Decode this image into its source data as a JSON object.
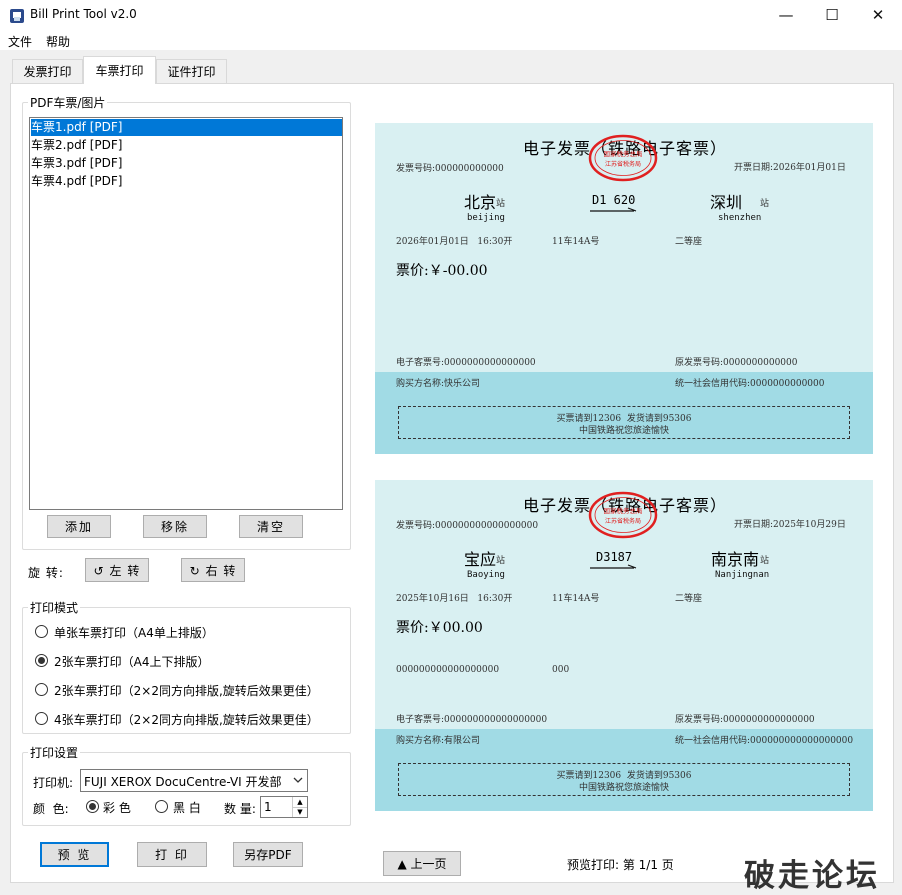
{
  "window": {
    "title": "Bill Print Tool v2.0",
    "minimize": "—",
    "maximize": "☐",
    "close": "✕"
  },
  "menu": {
    "file": "文件",
    "help": "帮助"
  },
  "tabs": [
    "发票打印",
    "车票打印",
    "证件打印"
  ],
  "file_group": {
    "title": "PDF车票/图片",
    "files": [
      "车票1.pdf [PDF]",
      "车票2.pdf [PDF]",
      "车票3.pdf [PDF]",
      "车票4.pdf [PDF]"
    ],
    "selected_index": 0,
    "add": "添加",
    "remove": "移除",
    "clear": "清空"
  },
  "rotate": {
    "label": "旋 转:",
    "left": "↺ 左 转",
    "right": "↻ 右 转"
  },
  "mode_group": {
    "title": "打印模式",
    "options": [
      "单张车票打印（A4单上排版）",
      "2张车票打印（A4上下排版）",
      "2张车票打印（2×2同方向排版,旋转后效果更佳）",
      "4张车票打印（2×2同方向排版,旋转后效果更佳）"
    ],
    "selected_index": 1
  },
  "settings_group": {
    "title": "打印设置",
    "printer_label": "打印机:",
    "printer_value": "FUJI XEROX DocuCentre-VI 开发部",
    "color_label": "颜  色:",
    "color_option": "彩 色",
    "bw_option": "黑 白",
    "qty_label": "数 量:",
    "qty_value": "1"
  },
  "actions": {
    "preview": "预 览",
    "print": "打 印",
    "save_pdf": "另存PDF"
  },
  "preview_nav": {
    "prev": "▲ 上一页",
    "status": "预览打印: 第 1/1 页"
  },
  "tickets": [
    {
      "title": "电子发票（铁路电子客票）",
      "invoice_no": "发票号码:000000000000",
      "date": "开票日期:2026年01月01日",
      "from_city": "北京",
      "from_pinyin": "beijing",
      "to_city": "深圳",
      "to_pinyin": "shenzhen",
      "station_suffix": "站",
      "train": "D1 620",
      "depart": "2026年01月01日   16:30开",
      "seat_no": "11车14A号",
      "seat_class": "二等座",
      "price": "票价:￥-00.00",
      "extra_id": "",
      "extra_code": "",
      "eticket_no": "电子客票号:0000000000000000",
      "orig_invoice": "原发票号码:0000000000000",
      "buyer": "购买方名称:快乐公司",
      "credit_code": "统一社会信用代码:0000000000000",
      "notice1": "买票请到12306  发货请到95306",
      "notice2": "中国铁路祝您旅途愉快"
    },
    {
      "title": "电子发票（铁路电子客票）",
      "invoice_no": "发票号码:000000000000000000",
      "date": "开票日期:2025年10月29日",
      "from_city": "宝应",
      "from_pinyin": "Baoying",
      "to_city": "南京南",
      "to_pinyin": "Nanjingnan",
      "station_suffix": "站",
      "train": "D3187",
      "depart": "2025年10月16日   16:30开",
      "seat_no": "11车14A号",
      "seat_class": "二等座",
      "price": "票价:￥00.00",
      "extra_id": "000000000000000000",
      "extra_code": "000",
      "eticket_no": "电子客票号:000000000000000000",
      "orig_invoice": "原发票号码:0000000000000000",
      "buyer": "购买方名称:有限公司",
      "credit_code": "统一社会信用代码:000000000000000000",
      "notice1": "买票请到12306  发货请到95306",
      "notice2": "中国铁路祝您旅途愉快"
    }
  ],
  "stamp": {
    "line1": "国家税务总局",
    "line2": "江苏省税务局"
  },
  "watermark": "破走论坛",
  "colors": {
    "selection": "#0078d7",
    "ticket_bg": "#d9f0f2",
    "ticket_band": "#a1dbe5",
    "stamp": "#e02020"
  }
}
